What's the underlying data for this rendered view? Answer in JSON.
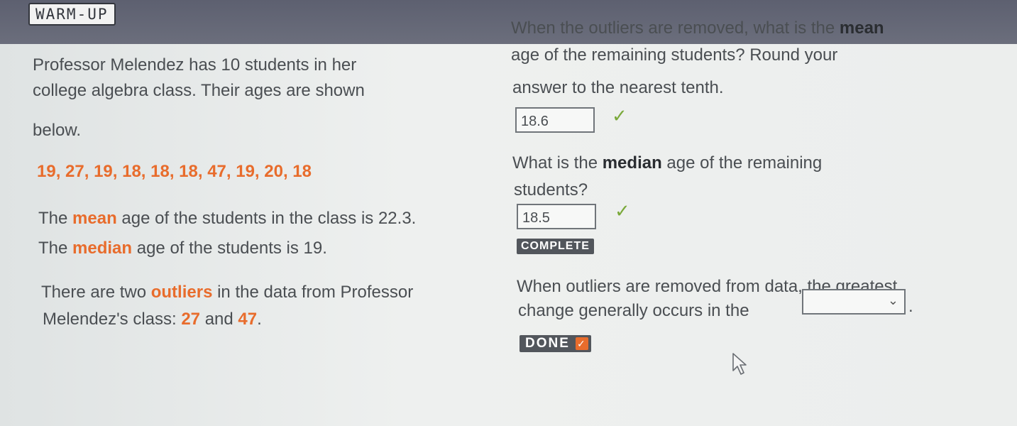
{
  "header": {
    "tag": "WARM-UP"
  },
  "intro": {
    "line1": "Professor Melendez has 10 students in her",
    "line2": "college algebra class. Their ages are shown",
    "line3": "below."
  },
  "ages_list": "19, 27, 19, 18, 18, 18, 47, 19, 20, 18",
  "mean_stmt": {
    "pre": "The ",
    "keyword": "mean",
    "post": " age of the students in the class is 22.3."
  },
  "median_stmt": {
    "pre": "The ",
    "keyword": "median",
    "post": " age of the students is 19."
  },
  "outliers_stmt": {
    "pre": "There are two ",
    "keyword": "outliers",
    "post": " in the data from Professor",
    "line2_pre": "Melendez's class: ",
    "val1": "27",
    "and": " and ",
    "val2": "47",
    "end": "."
  },
  "q1": {
    "line1_pre": "When the outliers are removed, what is the ",
    "keyword": "mean",
    "line2": "age of the remaining students? Round your",
    "line3": "answer to the nearest tenth.",
    "answer": "18.6"
  },
  "q2": {
    "pre": "What is the ",
    "keyword": "median",
    "post": " age of the remaining",
    "line2": "students?",
    "answer": "18.5"
  },
  "complete_label": "COMPLETE",
  "q3": {
    "line1": "When outliers are removed from data, the greatest",
    "line2": "change generally occurs in the",
    "end": ".",
    "selected": ""
  },
  "done_label": "DONE",
  "check_glyph": "✓",
  "colors": {
    "accent": "#e86c2c",
    "check": "#7aa93a",
    "button": "#52565c"
  }
}
